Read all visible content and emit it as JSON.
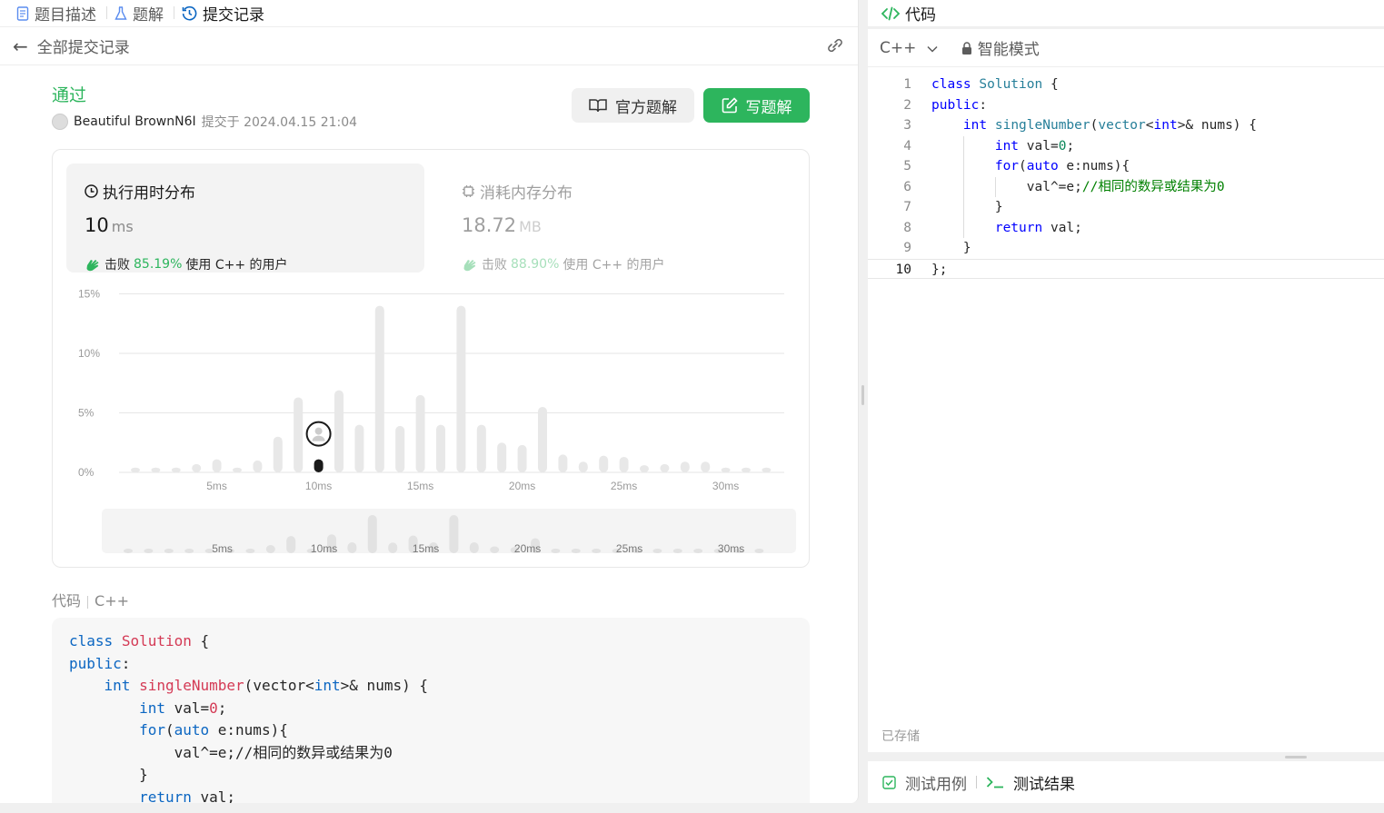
{
  "left_tabs": [
    {
      "label": "题目描述",
      "icon": "document-icon"
    },
    {
      "label": "题解",
      "icon": "flask-icon"
    },
    {
      "label": "提交记录",
      "icon": "history-icon",
      "active": true
    }
  ],
  "subbar": {
    "back_label": "全部提交记录"
  },
  "submission": {
    "status": "通过",
    "user": "Beautiful BrownN6I",
    "submitted_at": "提交于 2024.04.15 21:04"
  },
  "buttons": {
    "official": "官方题解",
    "write": "写题解"
  },
  "runtime": {
    "title": "执行用时分布",
    "value": "10",
    "unit": "ms",
    "beat_prefix": "击败",
    "beat_pct": "85.19%",
    "beat_suffix": "使用 C++ 的用户"
  },
  "memory": {
    "title": "消耗内存分布",
    "value": "18.72",
    "unit": "MB",
    "beat_prefix": "击败",
    "beat_pct": "88.90%",
    "beat_suffix": "使用 C++ 的用户"
  },
  "chart_data": {
    "type": "bar",
    "x": [
      1,
      2,
      3,
      4,
      5,
      6,
      7,
      8,
      9,
      10,
      11,
      12,
      13,
      14,
      15,
      16,
      17,
      18,
      19,
      20,
      21,
      22,
      23,
      24,
      25,
      26,
      27,
      28,
      29,
      30,
      31,
      32
    ],
    "values": [
      0.4,
      0.4,
      0.4,
      0.7,
      1.1,
      0.4,
      1.0,
      3.0,
      6.3,
      1.1,
      6.9,
      4.0,
      14.0,
      3.9,
      6.5,
      4.0,
      14.0,
      4.0,
      2.5,
      2.3,
      5.5,
      1.5,
      0.9,
      1.4,
      1.3,
      0.6,
      0.7,
      0.9,
      0.9,
      0.4,
      0.4,
      0.4
    ],
    "highlight_x": 10,
    "x_ticks": [
      "5ms",
      "10ms",
      "15ms",
      "20ms",
      "25ms",
      "30ms"
    ],
    "x_tick_values": [
      5,
      10,
      15,
      20,
      25,
      30
    ],
    "y_ticks": [
      "0%",
      "5%",
      "10%",
      "15%"
    ],
    "y_tick_values": [
      0,
      5,
      10,
      15
    ],
    "ylim": [
      0,
      15
    ],
    "grid": true,
    "colors": {
      "bar": "#e8e8e8",
      "highlight": "#1a1a1a"
    }
  },
  "code_section": {
    "label": "代码",
    "lang": "C++"
  },
  "code_lines": [
    "class Solution {",
    "public:",
    "    int singleNumber(vector<int>& nums) {",
    "        int val=0;",
    "        for(auto e:nums){",
    "            val^=e;//相同的数异或结果为0",
    "        }",
    "        return val;"
  ],
  "editor": {
    "title": "代码",
    "lang": "C++",
    "mode": "智能模式",
    "saved": "已存储",
    "line_numbers": [
      "1",
      "2",
      "3",
      "4",
      "5",
      "6",
      "7",
      "8",
      "9",
      "10"
    ]
  },
  "bottom_tabs": {
    "testcase": "测试用例",
    "result": "测试结果"
  },
  "colors": {
    "accent_green": "#2db55d",
    "keyword_blue": "#0b66c2"
  }
}
